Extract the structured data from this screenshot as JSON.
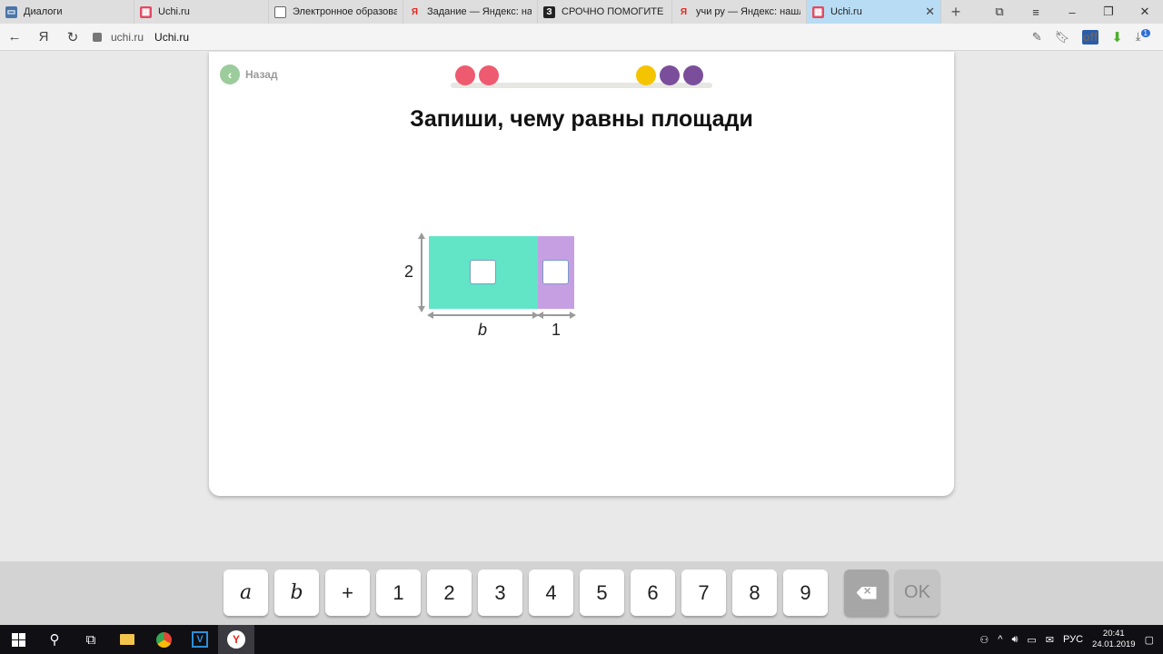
{
  "browser": {
    "tabs": [
      {
        "label": "Диалоги",
        "favicon": "vk-icon",
        "active": false
      },
      {
        "label": "Uchi.ru",
        "favicon": "uchi-icon",
        "active": false
      },
      {
        "label": "Электронное образова",
        "favicon": "document-icon",
        "active": false
      },
      {
        "label": "Задание — Яндекс: наш",
        "favicon": "yandex-icon",
        "active": false
      },
      {
        "label": "СРОЧНО ПОМОГИТЕ Д",
        "favicon": "znanija-icon",
        "active": false
      },
      {
        "label": "учи ру — Яндекс: нашл",
        "favicon": "yandex-icon",
        "active": false
      },
      {
        "label": "Uchi.ru",
        "favicon": "uchi-icon",
        "active": true
      }
    ],
    "url_host": "uchi.ru",
    "page_title": "Uchi.ru",
    "yandex_button": "Я",
    "downloads_badge": "1",
    "ext_off_label": "off"
  },
  "page": {
    "back_label": "Назад",
    "heading": "Запиши, чему равны площади",
    "progress_dots": [
      {
        "color": "#ee5a6f"
      },
      {
        "color": "#ee5a6f"
      },
      {
        "color": "#f5c400"
      },
      {
        "color": "#7a4e9a"
      },
      {
        "color": "#7a4e9a"
      }
    ],
    "diagram": {
      "height_label": "2",
      "width_left_label": "b",
      "width_right_label": "1",
      "left_color": "#61e5c6",
      "right_color": "#c69fe3"
    }
  },
  "keypad": {
    "keys": [
      "a",
      "b",
      "+",
      "1",
      "2",
      "3",
      "4",
      "5",
      "6",
      "7",
      "8",
      "9"
    ],
    "delete_icon": "backspace-icon",
    "ok_label": "OK"
  },
  "taskbar": {
    "language": "РУС",
    "time": "20:41",
    "date": "24.01.2019"
  }
}
